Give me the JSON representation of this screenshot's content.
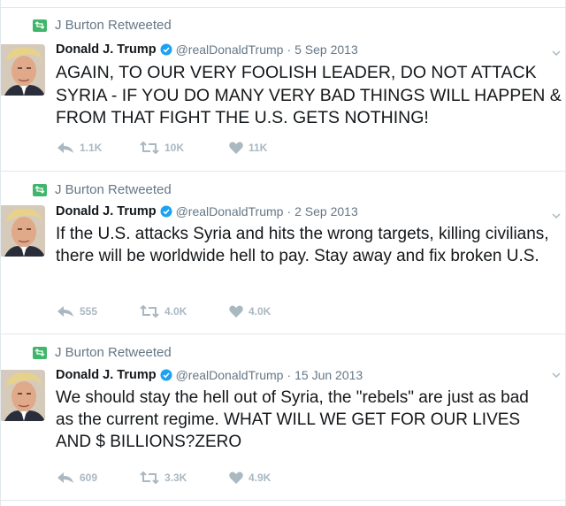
{
  "tweets": [
    {
      "retweeted_by": "J Burton Retweeted",
      "name": "Donald J. Trump",
      "handle": "@realDonaldTrump",
      "separator": "·",
      "date": "5 Sep 2013",
      "text": "AGAIN, TO OUR VERY FOOLISH LEADER, DO NOT ATTACK SYRIA - IF YOU DO MANY VERY BAD THINGS WILL HAPPEN & FROM THAT FIGHT THE U.S. GETS NOTHING!",
      "replies": "1.1K",
      "retweets": "10K",
      "likes": "11K"
    },
    {
      "retweeted_by": "J Burton Retweeted",
      "name": "Donald J. Trump",
      "handle": "@realDonaldTrump",
      "separator": "·",
      "date": "2 Sep 2013",
      "text": "If the U.S. attacks Syria and hits the wrong targets, killing civilians, there will be worldwide hell to pay. Stay away and fix broken U.S.",
      "replies": "555",
      "retweets": "4.0K",
      "likes": "4.0K"
    },
    {
      "retweeted_by": "J Burton Retweeted",
      "name": "Donald J. Trump",
      "handle": "@realDonaldTrump",
      "separator": "·",
      "date": "15 Jun 2013",
      "text": "We should stay the hell out of Syria, the \"rebels\" are just as bad as the current regime. WHAT WILL WE GET FOR OUR LIVES AND $ BILLIONS?ZERO",
      "replies": "609",
      "retweets": "3.3K",
      "likes": "4.9K"
    }
  ],
  "colors": {
    "retweet_badge": "#3fb66a",
    "verified": "#1da1f2",
    "muted_text": "#657786",
    "action_icons": "#aab8c2",
    "divider": "#e1e8ed"
  },
  "icons": {
    "context": "retweet-icon",
    "verified": "verified-badge-icon",
    "menu": "chevron-down-icon",
    "reply": "reply-icon",
    "retweet": "retweet-icon",
    "like": "heart-icon"
  }
}
